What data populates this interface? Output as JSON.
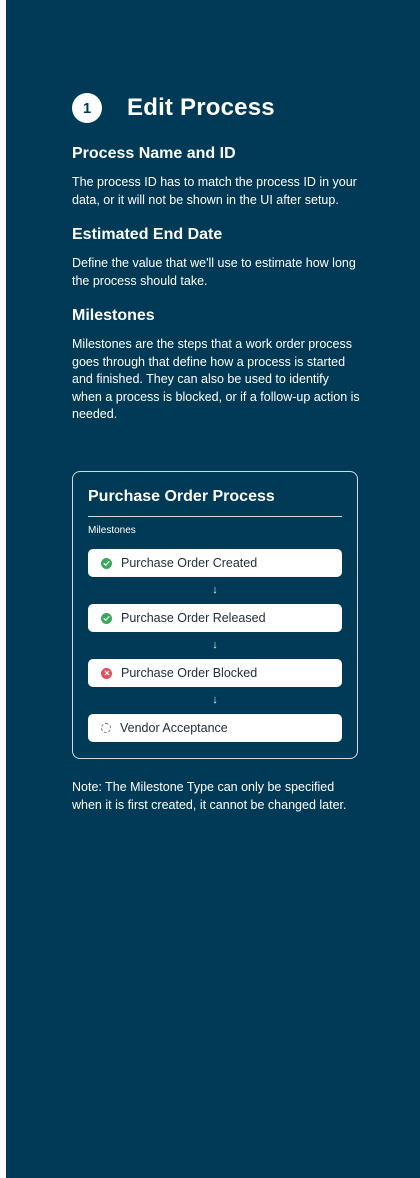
{
  "step": {
    "number": "1",
    "title": "Edit Process"
  },
  "sections": [
    {
      "title": "Process Name and ID",
      "text": "The process ID has to match the process ID in your data, or it will not be shown in the UI after setup."
    },
    {
      "title": "Estimated End Date",
      "text": "Define the value that we'll use to estimate how long the process should take."
    },
    {
      "title": "Milestones",
      "text": "Milestones are the steps that a work order process goes through that define how a process is started and finished. They can also be used to identify when a process is blocked, or if a follow-up action is needed."
    }
  ],
  "card": {
    "title": "Purchase Order Process",
    "subtitle": "Milestones",
    "arrow_glyph": "↓",
    "milestones": [
      {
        "label": "Purchase Order Created",
        "status": "done",
        "icon": "check-circle-icon"
      },
      {
        "label": "Purchase Order Released",
        "status": "done",
        "icon": "check-circle-icon"
      },
      {
        "label": "Purchase Order Blocked",
        "status": "blocked",
        "icon": "x-circle-icon"
      },
      {
        "label": "Vendor Acceptance",
        "status": "pending",
        "icon": "dashed-circle-icon"
      }
    ]
  },
  "note": "Note: The Milestone Type can only be specified when it is first created, it cannot be changed later.",
  "colors": {
    "panel_background": "#003a56",
    "done": "#3aa85d",
    "blocked": "#e0505a"
  }
}
